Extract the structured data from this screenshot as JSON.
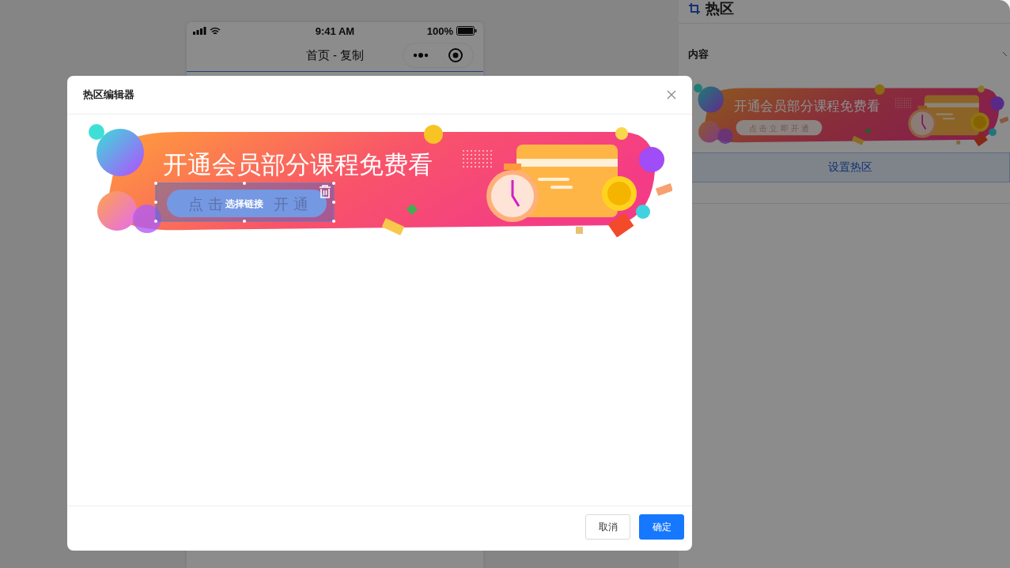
{
  "phone": {
    "status_bar": {
      "time": "9:41 AM",
      "battery": "100%"
    },
    "title": "首页 - 复制"
  },
  "side_panel": {
    "title": "热区",
    "section": {
      "label": "内容",
      "expanded": true
    },
    "banner": {
      "title": "开通会员部分课程免费看",
      "button_text": [
        "点 击 立 即 开 通"
      ]
    },
    "action": "设置热区"
  },
  "modal": {
    "title": "热区编辑器",
    "banner": {
      "title": "开通会员部分课程免费看",
      "button_text": [
        "点 击",
        "开 通"
      ]
    },
    "hotspots": [
      {
        "label": "选择链接",
        "selected": true
      }
    ],
    "buttons": [
      {
        "label": "取消",
        "kind": "default"
      },
      {
        "label": "确定",
        "kind": "primary"
      }
    ]
  }
}
